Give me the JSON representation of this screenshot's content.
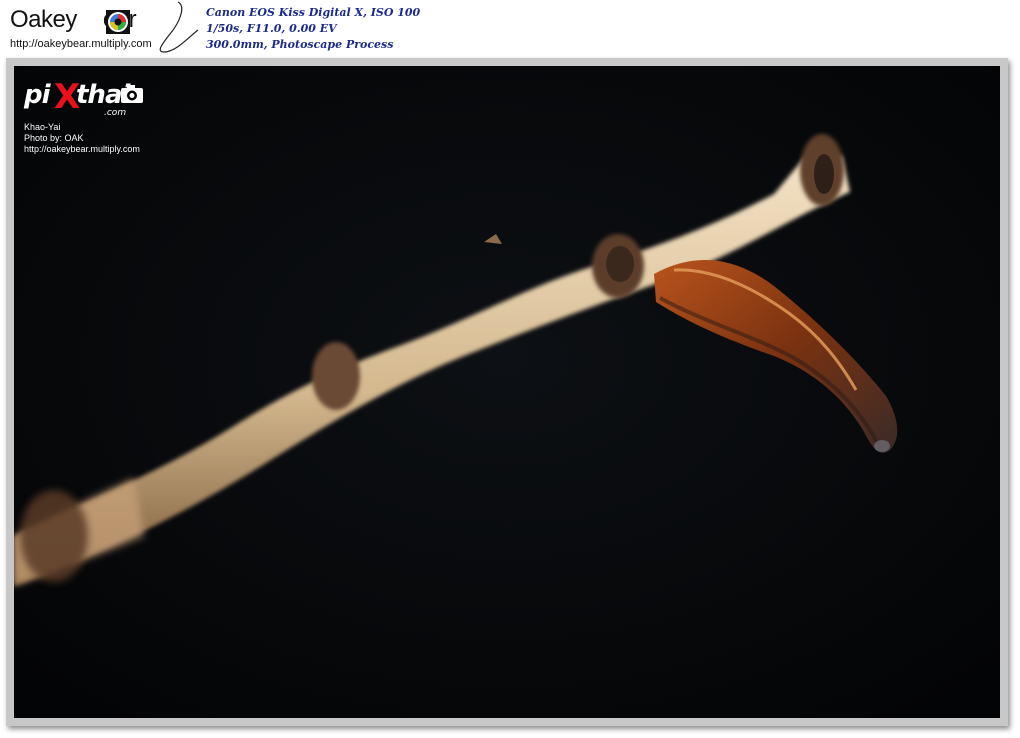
{
  "header": {
    "logo_left": "Oakey",
    "logo_right": "ear",
    "logo_url": "http://oakeybear.multiply.com",
    "exif": [
      "Canon EOS Kiss Digital X, ISO 100",
      "1/50s, F11.0, 0.00 EV",
      "300.0mm, Photoscape Process"
    ]
  },
  "watermark": {
    "brand_pi": "pi",
    "brand_x": "X",
    "brand_thai": "thai",
    "brand_suffix": ".com",
    "lines": [
      "Khao-Yai",
      "Photo by: OAK",
      "http://oakeybear.multiply.com"
    ]
  },
  "colors": {
    "background": "#050608",
    "frame": "#c8c8c8",
    "exif_text": "#1a2a8a",
    "brand_red": "#e8101a"
  }
}
